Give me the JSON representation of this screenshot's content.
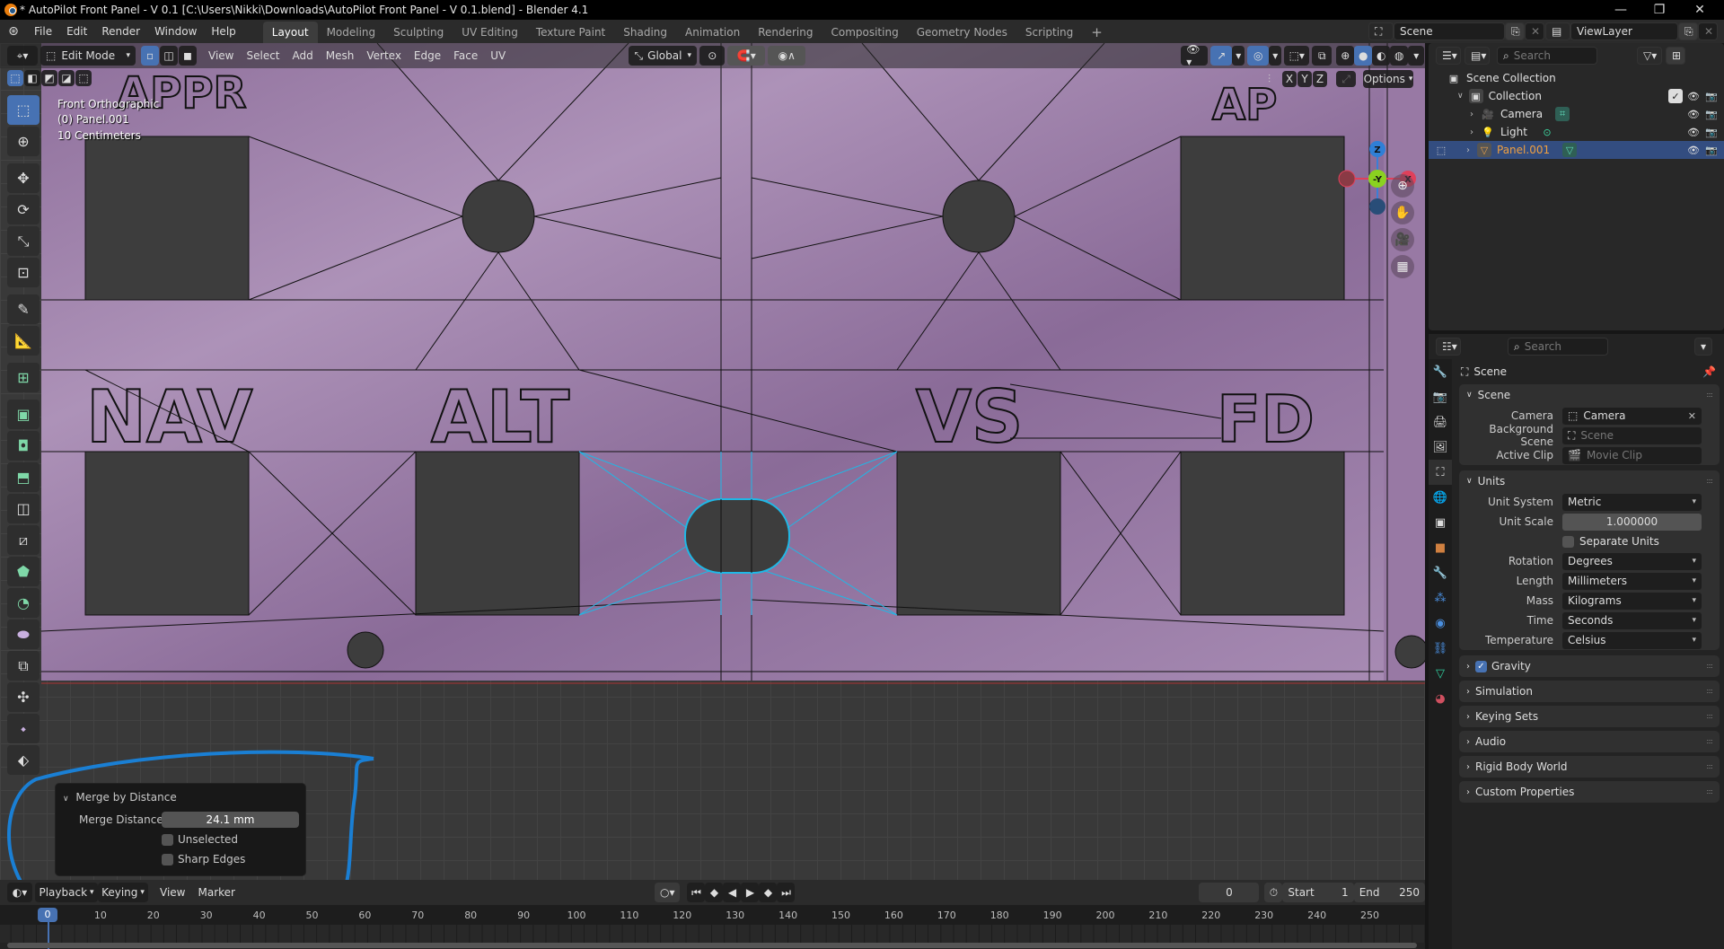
{
  "window": {
    "title": "* AutoPilot Front Panel - V 0.1 [C:\\Users\\Nikki\\Downloads\\AutoPilot Front Panel - V 0.1.blend] - Blender 4.1",
    "controls": {
      "minimize": "—",
      "maximize": "❐",
      "close": "✕"
    }
  },
  "menubar": {
    "menus": [
      "File",
      "Edit",
      "Render",
      "Window",
      "Help"
    ],
    "workspaces": [
      "Layout",
      "Modeling",
      "Sculpting",
      "UV Editing",
      "Texture Paint",
      "Shading",
      "Animation",
      "Rendering",
      "Compositing",
      "Geometry Nodes",
      "Scripting"
    ],
    "active_workspace": "Layout",
    "add_workspace": "+",
    "scene_field": "Scene",
    "viewlayer_field": "ViewLayer"
  },
  "viewport": {
    "mode": "Edit Mode",
    "menus": [
      "View",
      "Select",
      "Add",
      "Mesh",
      "Vertex",
      "Edge",
      "Face",
      "UV"
    ],
    "orientation": "Global",
    "options_label": "Options",
    "axis_buttons": [
      "X",
      "Y",
      "Z"
    ],
    "overlay": {
      "view_name": "Front Orthographic",
      "object": "(0) Panel.001",
      "scale": "10 Centimeters"
    },
    "gizmo": {
      "z": "Z",
      "y": "-Y",
      "x": "X"
    },
    "panel_labels": [
      "APPR",
      "NAV",
      "ALT",
      "VS",
      "FD",
      "AP"
    ],
    "colors": {
      "mesh_face": "#9a7aa6",
      "selected_edge": "#1fb8e6",
      "accent": "#4772b3"
    }
  },
  "operator_panel": {
    "title": "Merge by Distance",
    "merge_distance_label": "Merge Distance",
    "merge_distance_value": "24.1 mm",
    "unselected_label": "Unselected",
    "unselected_checked": false,
    "sharp_edges_label": "Sharp Edges",
    "sharp_edges_checked": false
  },
  "timeline": {
    "menus": [
      "Playback",
      "Keying",
      "View",
      "Marker"
    ],
    "current_frame": "0",
    "current_frame_field": "0",
    "start_label": "Start",
    "start_value": "1",
    "end_label": "End",
    "end_value": "250",
    "ticks": [
      "0",
      "10",
      "20",
      "30",
      "40",
      "50",
      "60",
      "70",
      "80",
      "90",
      "100",
      "110",
      "120",
      "130",
      "140",
      "150",
      "160",
      "170",
      "180",
      "190",
      "200",
      "210",
      "220",
      "230",
      "240",
      "250"
    ]
  },
  "outliner": {
    "search_placeholder": "Search",
    "root": "Scene Collection",
    "collection": "Collection",
    "collection_checked": true,
    "items": [
      {
        "name": "Camera",
        "type": "camera"
      },
      {
        "name": "Light",
        "type": "light"
      },
      {
        "name": "Panel.001",
        "type": "mesh",
        "selected": true
      }
    ]
  },
  "properties": {
    "search_placeholder": "Search",
    "context": "Scene",
    "scene_panel": {
      "title": "Scene",
      "camera_label": "Camera",
      "camera_value": "Camera",
      "background_scene_label": "Background Scene",
      "background_scene_value": "Scene",
      "active_clip_label": "Active Clip",
      "active_clip_value": "Movie Clip"
    },
    "units_panel": {
      "title": "Units",
      "rows": [
        {
          "label": "Unit System",
          "value": "Metric",
          "kind": "dropdown"
        },
        {
          "label": "Unit Scale",
          "value": "1.000000",
          "kind": "number"
        },
        {
          "label": "",
          "value": "Separate Units",
          "kind": "checkbox"
        },
        {
          "label": "Rotation",
          "value": "Degrees",
          "kind": "dropdown"
        },
        {
          "label": "Length",
          "value": "Millimeters",
          "kind": "dropdown"
        },
        {
          "label": "Mass",
          "value": "Kilograms",
          "kind": "dropdown"
        },
        {
          "label": "Time",
          "value": "Seconds",
          "kind": "dropdown"
        },
        {
          "label": "Temperature",
          "value": "Celsius",
          "kind": "dropdown"
        }
      ]
    },
    "collapsed_panels": [
      "Gravity",
      "Simulation",
      "Keying Sets",
      "Audio",
      "Rigid Body World",
      "Custom Properties"
    ],
    "gravity_checked": true,
    "tabs": [
      "tool",
      "render",
      "output",
      "view-layer",
      "scene",
      "world",
      "collection",
      "object",
      "modifiers",
      "particles",
      "physics",
      "constraints",
      "data",
      "material"
    ]
  }
}
